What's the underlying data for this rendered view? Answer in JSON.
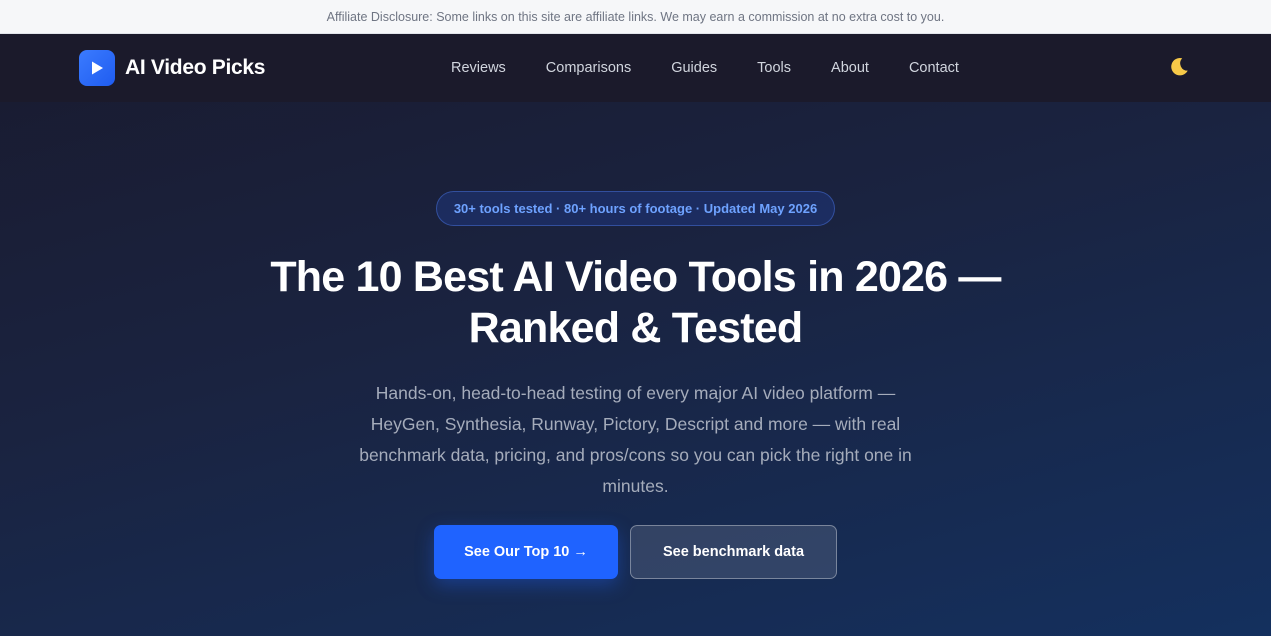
{
  "disclosure": {
    "text": "Affiliate Disclosure: Some links on this site are affiliate links. We may earn a commission at no extra cost to you."
  },
  "header": {
    "brand_name": "AI Video Picks",
    "brand_icon": "play-icon",
    "nav": [
      {
        "label": "Reviews"
      },
      {
        "label": "Comparisons"
      },
      {
        "label": "Guides"
      },
      {
        "label": "Tools"
      },
      {
        "label": "About"
      },
      {
        "label": "Contact"
      }
    ],
    "theme_toggle_icon": "moon-icon",
    "theme_toggle_glyph": "🌙"
  },
  "hero": {
    "stats_pill": "30+ tools tested · 80+ hours of footage · Updated May 2026",
    "title": "The 10 Best AI Video Tools in 2026 — Ranked & Tested",
    "subtitle": "Hands-on, head-to-head testing of every major AI video platform — HeyGen, Synthesia, Runway, Pictory, Descript and more — with real benchmark data, pricing, and pros/cons so you can pick the right one in minutes.",
    "primary_cta": "See Our Top 10 →",
    "secondary_cta": "See benchmark data"
  },
  "colors": {
    "accent": "#1f63ff",
    "pill_text": "#6ea2ff",
    "background_top": "#191a2e",
    "background_bottom": "#14305e"
  }
}
